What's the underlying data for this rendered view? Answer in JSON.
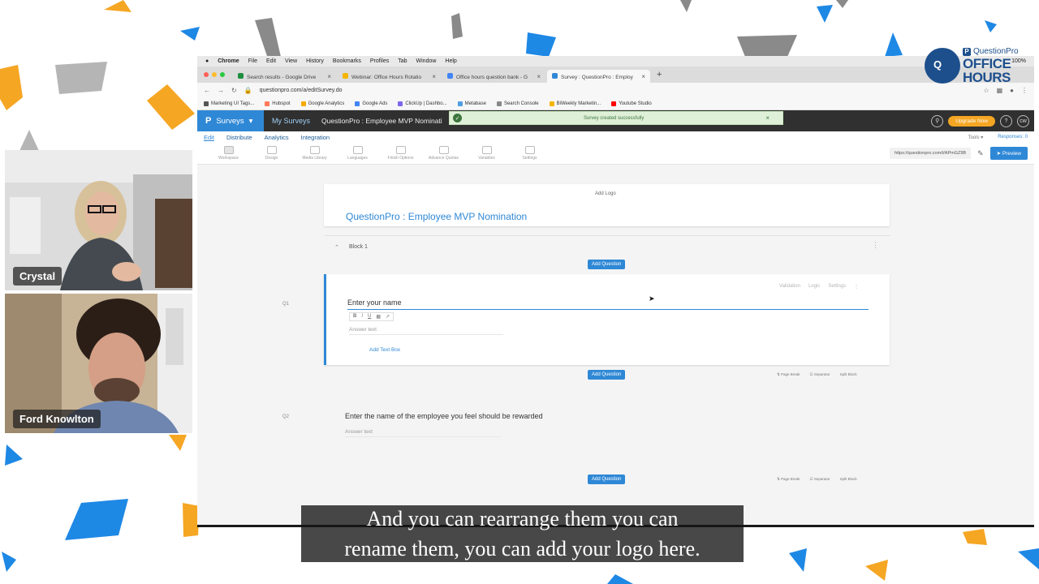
{
  "participants": [
    {
      "name": "Crystal"
    },
    {
      "name": "Ford Knowlton"
    }
  ],
  "overlay_logo": {
    "brand": "QuestionPro",
    "line1": "OFFICE",
    "line2": "HOURS"
  },
  "caption": {
    "line1": "And you can rearrange them you can",
    "line2": "rename them, you can add your logo here."
  },
  "mac_menu": {
    "app": "Chrome",
    "items": [
      "File",
      "Edit",
      "View",
      "History",
      "Bookmarks",
      "Profiles",
      "Tab",
      "Window",
      "Help"
    ],
    "battery": "100%"
  },
  "browser": {
    "tabs": [
      {
        "title": "Search results - Google Drive",
        "color": "#1e8e3e"
      },
      {
        "title": "Webinar: Office Hours Rotatio",
        "color": "#f4b400"
      },
      {
        "title": "Office hours question bank - G",
        "color": "#4285f4"
      },
      {
        "title": "Survey : QuestionPro : Employ",
        "color": "#2f88d6"
      }
    ],
    "url": "questionpro.com/a/editSurvey.do",
    "bookmarks": [
      {
        "label": "Marketing UI Tags...",
        "color": "#555555"
      },
      {
        "label": "Hubspot",
        "color": "#ff7a59"
      },
      {
        "label": "Google Analytics",
        "color": "#f9ab00"
      },
      {
        "label": "Google Ads",
        "color": "#4285f4"
      },
      {
        "label": "ClickUp | Dashbo...",
        "color": "#7b68ee"
      },
      {
        "label": "Metabase",
        "color": "#509ee3"
      },
      {
        "label": "Search Console",
        "color": "#888888"
      },
      {
        "label": "BiWeekly Marketin...",
        "color": "#f4b400"
      },
      {
        "label": "Youtube Studio",
        "color": "#ff0000"
      }
    ]
  },
  "app": {
    "brand": "Surveys",
    "brand_letter": "P",
    "nav_link": "My Surveys",
    "survey_name": "QuestionPro : Employee MVP Nominati",
    "toast": "Survey created successfully",
    "upgrade": "Upgrade Now",
    "avatar": "cw",
    "subnav": [
      "Edit",
      "Distribute",
      "Analytics",
      "Integration"
    ],
    "tools_label": "Tools",
    "responses_label": "Responses: 0",
    "toolbar": [
      "Workspace",
      "Design",
      "Media Library",
      "Languages",
      "Finish Options",
      "Advance Quotas",
      "Variables",
      "Settings"
    ],
    "share_link": "https://questionpro.com/t/APmGZ9B",
    "preview": "Preview"
  },
  "survey": {
    "add_logo": "Add Logo",
    "title": "QuestionPro : Employee MVP Nomination",
    "block_label": "Block 1",
    "add_question": "Add Question",
    "question_tools": [
      "Validation",
      "Logic",
      "Settings"
    ],
    "format_tools": [
      "B",
      "I",
      "U"
    ],
    "answer_placeholder": "Answer text",
    "add_text_box": "Add Text Box",
    "row_links": [
      "Page Break",
      "Separator",
      "Split Block"
    ],
    "questions": [
      {
        "number": "Q1",
        "text": "Enter your name"
      },
      {
        "number": "Q2",
        "text": "Enter the name of the employee you feel should be rewarded"
      }
    ]
  }
}
